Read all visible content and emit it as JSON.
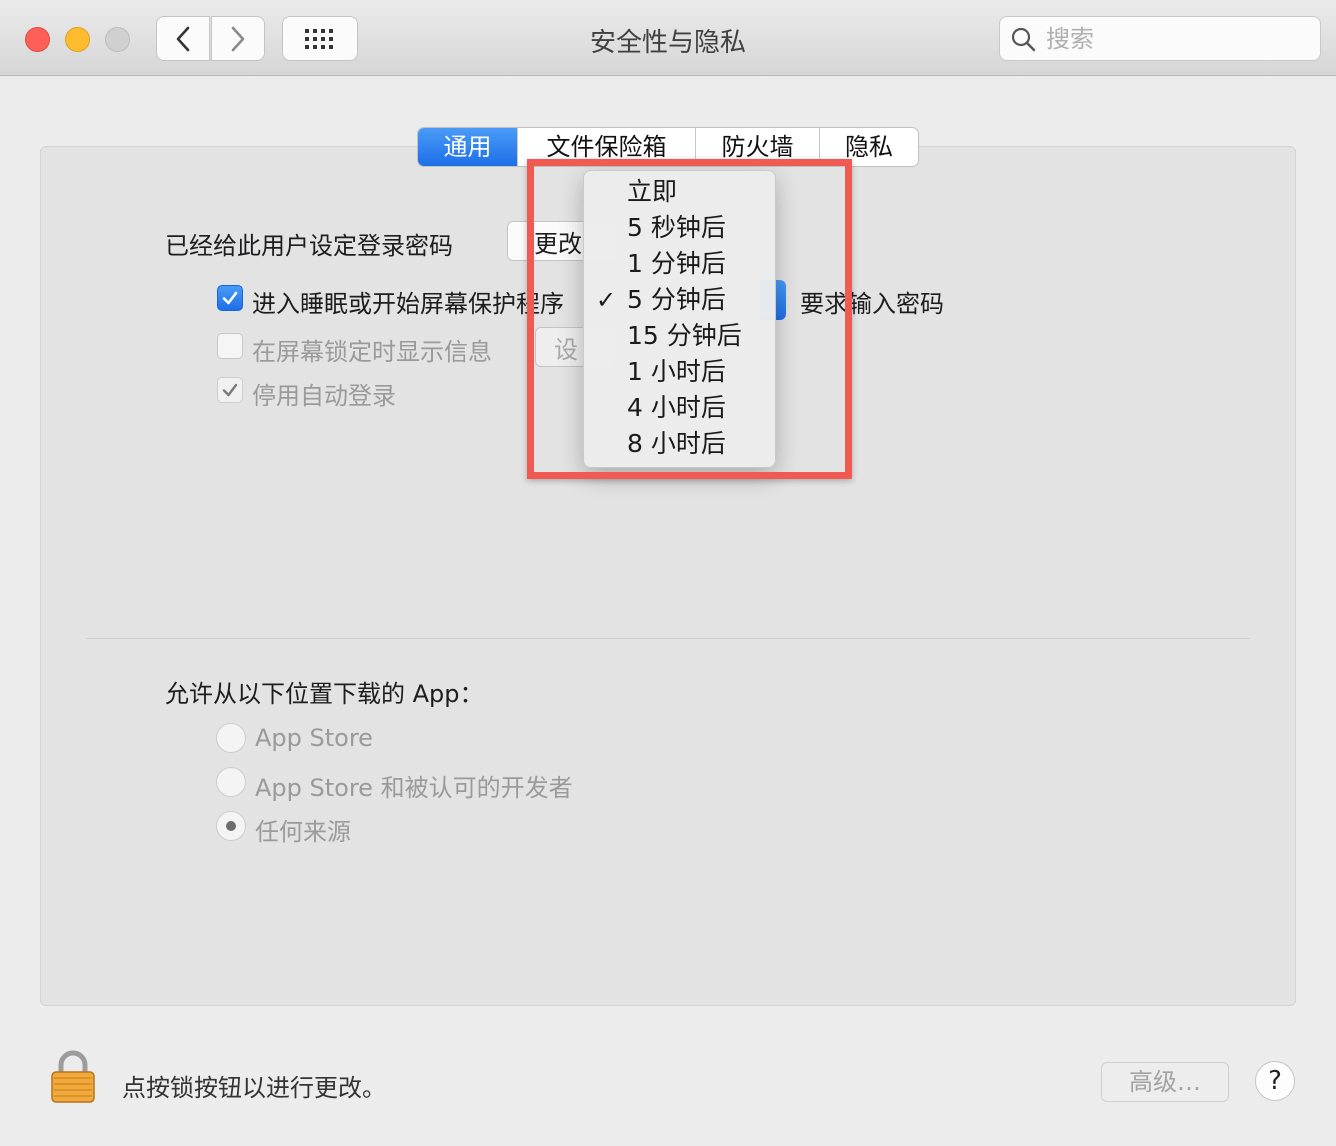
{
  "window": {
    "title": "安全性与隐私",
    "search_placeholder": "搜索"
  },
  "tabs": [
    "通用",
    "文件保险箱",
    "防火墙",
    "隐私"
  ],
  "general": {
    "password_label": "已经给此用户设定登录密码",
    "change_password_button": "更改",
    "require_password": {
      "prefix": "进入睡眠或开始屏幕保护程序",
      "suffix": "要求输入密码",
      "checked": true
    },
    "show_message": {
      "label": "在屏幕锁定时显示信息",
      "button": "设",
      "checked": false
    },
    "disable_autologin": {
      "label": "停用自动登录",
      "checked": true
    }
  },
  "dropdown": {
    "options": [
      "立即",
      "5 秒钟后",
      "1 分钟后",
      "5 分钟后",
      "15 分钟后",
      "1 小时后",
      "4 小时后",
      "8 小时后"
    ],
    "selected_index": 3,
    "check_mark": "✓"
  },
  "downloads": {
    "heading": "允许从以下位置下载的 App：",
    "options": [
      "App Store",
      "App Store 和被认可的开发者",
      "任何来源"
    ],
    "selected_index": 2
  },
  "footer": {
    "lock_text": "点按锁按钮以进行更改。",
    "advanced_button": "高级…",
    "help_button": "?"
  },
  "colors": {
    "accent": "#1d6fe8",
    "highlight_box": "#f05a52"
  }
}
